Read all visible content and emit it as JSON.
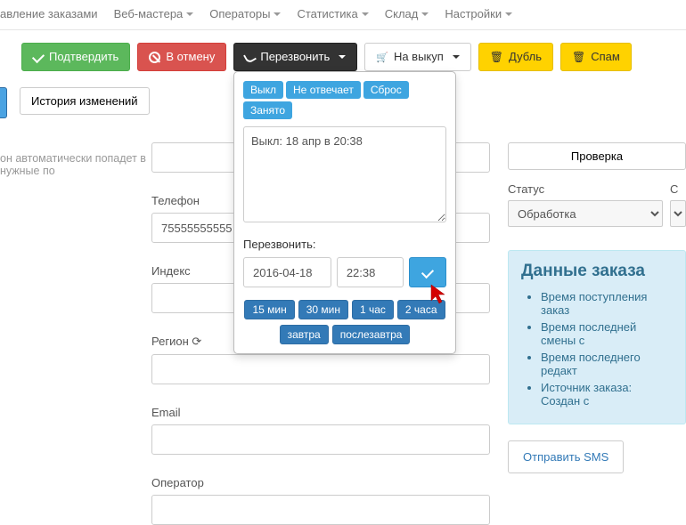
{
  "nav": {
    "items": [
      "авление заказами",
      "Веб-мастера",
      "Операторы",
      "Статистика",
      "Склад",
      "Настройки"
    ],
    "has_caret": [
      false,
      true,
      true,
      true,
      true,
      true
    ]
  },
  "toolbar": {
    "confirm": "Подтвердить",
    "cancel": "В отмену",
    "recall": "Перезвонить",
    "buyout": "На выкуп",
    "dup": "Дубль",
    "spam": "Спам"
  },
  "sidebar": {
    "history_btn": "История изменений",
    "helper": "он автоматически попадет в нужные по"
  },
  "fields": {
    "phone_label": "Телефон",
    "phone_value": "75555555555",
    "index_label": "Индекс",
    "region_label": "Регион",
    "email_label": "Email",
    "operator_label": "Оператор"
  },
  "popover": {
    "tags": [
      "Выкл",
      "Не отвечает",
      "Сброс",
      "Занято"
    ],
    "note_value": "Выкл: 18 апр в 20:38",
    "recall_label": "Перезвонить:",
    "date_value": "2016-04-18",
    "time_value": "22:38",
    "quick": [
      "15 мин",
      "30 мин",
      "1 час",
      "2 часа",
      "завтра",
      "послезавтра"
    ]
  },
  "right": {
    "check_btn": "Проверка",
    "status_label": "Статус",
    "status_value": "Обработка",
    "extra_label": "С",
    "panel_title": "Данные заказа",
    "panel_items": [
      "Время поступления заказ",
      "Время последней смены с",
      "Время последнего редакт",
      "Источник заказа: Создан с"
    ],
    "sms_link": "Отправить SMS"
  }
}
